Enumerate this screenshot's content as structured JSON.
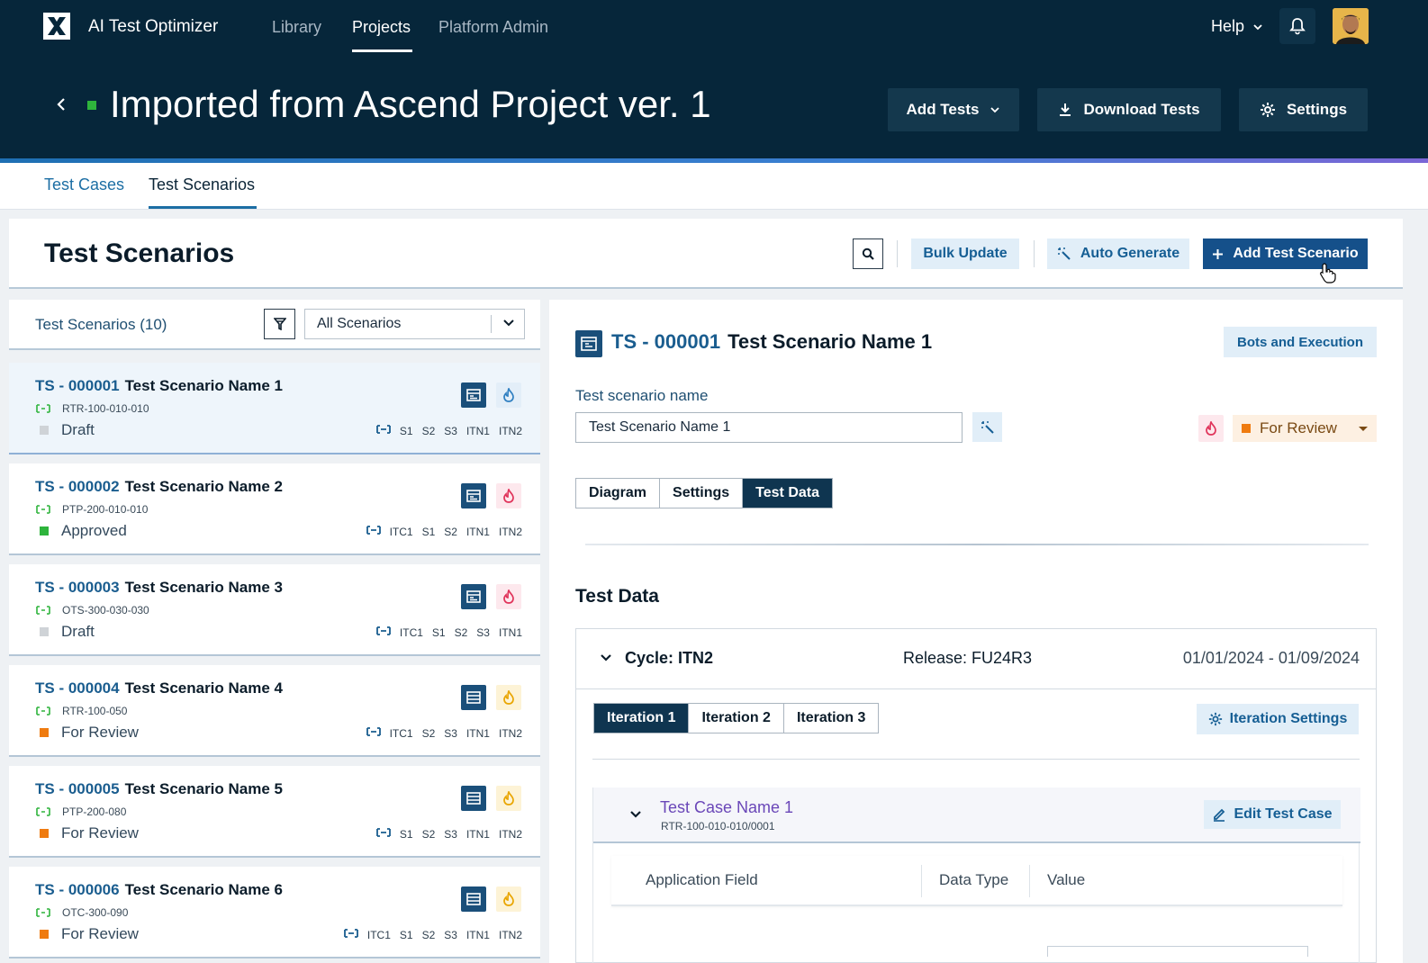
{
  "app": {
    "title": "AI Test Optimizer",
    "nav": [
      "Library",
      "Projects",
      "Platform Admin"
    ],
    "help": "Help"
  },
  "project": {
    "title": "Imported from Ascend Project ver. 1",
    "status_color": "#2eb43c",
    "buttons": {
      "add_tests": "Add Tests",
      "download_tests": "Download Tests",
      "settings": "Settings"
    }
  },
  "subtabs": [
    "Test Cases",
    "Test Scenarios"
  ],
  "page": {
    "title": "Test Scenarios",
    "bulk_update": "Bulk Update",
    "auto_generate": "Auto Generate",
    "add_test_scenario": "Add Test Scenario"
  },
  "list": {
    "count_label": "Test Scenarios (10)",
    "filter_value": "All Scenarios",
    "items": [
      {
        "id": "TS - 000001",
        "name": "Test Scenario Name 1",
        "code": "RTR-100-010-010",
        "status": "Draft",
        "status_color": "#cfd3d7",
        "icon_b": "fire-blue",
        "tags": [
          "S1",
          "S2",
          "S3",
          "ITN1",
          "ITN2"
        ]
      },
      {
        "id": "TS - 000002",
        "name": "Test Scenario Name 2",
        "code": "PTP-200-010-010",
        "status": "Approved",
        "status_color": "#2eb43c",
        "icon_b": "fire-red",
        "tags": [
          "ITC1",
          "S1",
          "S2",
          "ITN1",
          "ITN2"
        ]
      },
      {
        "id": "TS - 000003",
        "name": "Test Scenario Name 3",
        "code": "OTS-300-030-030",
        "status": "Draft",
        "status_color": "#cfd3d7",
        "icon_b": "fire-red",
        "tags": [
          "ITC1",
          "S1",
          "S2",
          "S3",
          "ITN1"
        ]
      },
      {
        "id": "TS - 000004",
        "name": "Test Scenario Name 4",
        "code": "RTR-100-050",
        "status": "For Review",
        "status_color": "#ef7b10",
        "icon_b": "fire-yellow",
        "tags": [
          "ITC1",
          "S2",
          "S3",
          "ITN1",
          "ITN2"
        ]
      },
      {
        "id": "TS - 000005",
        "name": "Test Scenario Name 5",
        "code": "PTP-200-080",
        "status": "For Review",
        "status_color": "#ef7b10",
        "icon_b": "fire-yellow",
        "tags": [
          "S1",
          "S2",
          "S3",
          "ITN1",
          "ITN2"
        ]
      },
      {
        "id": "TS - 000006",
        "name": "Test Scenario Name 6",
        "code": "OTC-300-090",
        "status": "For Review",
        "status_color": "#ef7b10",
        "icon_b": "fire-yellow",
        "tags": [
          "ITC1",
          "S1",
          "S2",
          "S3",
          "ITN1",
          "ITN2"
        ]
      }
    ]
  },
  "detail": {
    "id": "TS - 000001",
    "name": "Test Scenario Name 1",
    "bots_button": "Bots and Execution",
    "field_label": "Test scenario name",
    "field_value": "Test Scenario Name 1",
    "status": "For Review",
    "tabs": [
      "Diagram",
      "Settings",
      "Test Data"
    ],
    "active_tab": "Test Data",
    "section_title": "Test Data",
    "cycle": {
      "label": "Cycle: ITN2",
      "release": "Release: FU24R3",
      "dates": "01/01/2024 - 01/09/2024",
      "iterations": [
        "Iteration 1",
        "Iteration 2",
        "Iteration 3"
      ],
      "iteration_settings": "Iteration Settings"
    },
    "test_case": {
      "name": "Test Case Name 1",
      "code": "RTR-100-010-010/0001",
      "edit_button": "Edit Test Case",
      "columns": [
        "Application Field",
        "Data Type",
        "Value"
      ]
    }
  },
  "colors": {
    "header_bg": "#06263a",
    "primary": "#15508a",
    "accent_light": "#e1eef8",
    "link": "#1a5d8f"
  }
}
